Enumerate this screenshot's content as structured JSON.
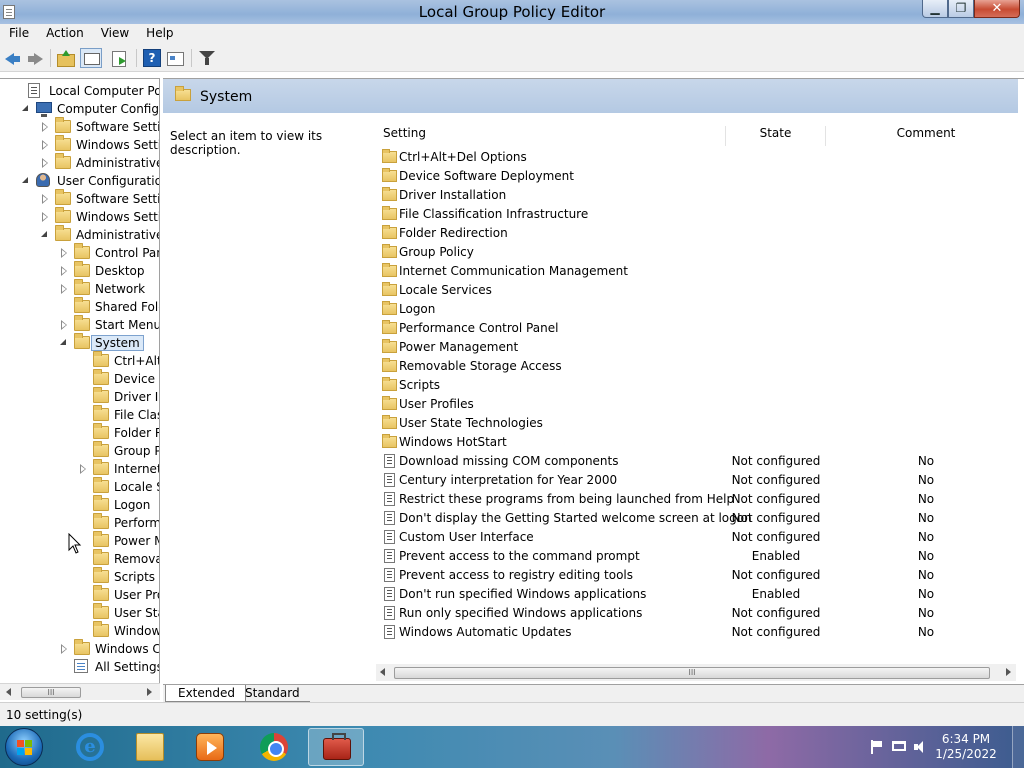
{
  "window": {
    "title": "Local Group Policy Editor"
  },
  "menu": [
    "File",
    "Action",
    "View",
    "Help"
  ],
  "toolbar": {
    "help_glyph": "?"
  },
  "tree": [
    {
      "label": "Local Computer Policy",
      "indent": 0,
      "arrow": "none",
      "icon": "policy"
    },
    {
      "label": "Computer Configura",
      "indent": 1,
      "arrow": "open",
      "icon": "computer"
    },
    {
      "label": "Software Settings",
      "indent": 2,
      "arrow": "closed",
      "icon": "folder"
    },
    {
      "label": "Windows Setting",
      "indent": 2,
      "arrow": "closed",
      "icon": "folder"
    },
    {
      "label": "Administrative Te",
      "indent": 2,
      "arrow": "closed",
      "icon": "folder"
    },
    {
      "label": "User Configuration",
      "indent": 1,
      "arrow": "open",
      "icon": "user"
    },
    {
      "label": "Software Settings",
      "indent": 2,
      "arrow": "closed",
      "icon": "folder"
    },
    {
      "label": "Windows Setting",
      "indent": 2,
      "arrow": "closed",
      "icon": "folder"
    },
    {
      "label": "Administrative Te",
      "indent": 2,
      "arrow": "open",
      "icon": "folder"
    },
    {
      "label": "Control Panel",
      "indent": 3,
      "arrow": "closed",
      "icon": "folder"
    },
    {
      "label": "Desktop",
      "indent": 3,
      "arrow": "closed",
      "icon": "folder"
    },
    {
      "label": "Network",
      "indent": 3,
      "arrow": "closed",
      "icon": "folder"
    },
    {
      "label": "Shared Folder",
      "indent": 3,
      "arrow": "none",
      "icon": "folder"
    },
    {
      "label": "Start Menu ar",
      "indent": 3,
      "arrow": "closed",
      "icon": "folder"
    },
    {
      "label": "System",
      "indent": 3,
      "arrow": "open",
      "icon": "folder",
      "selected": true
    },
    {
      "label": "Ctrl+Alt+I",
      "indent": 4,
      "arrow": "none",
      "icon": "folder"
    },
    {
      "label": "Device So",
      "indent": 4,
      "arrow": "none",
      "icon": "folder"
    },
    {
      "label": "Driver Inst",
      "indent": 4,
      "arrow": "none",
      "icon": "folder"
    },
    {
      "label": "File Classi",
      "indent": 4,
      "arrow": "none",
      "icon": "folder"
    },
    {
      "label": "Folder Rec",
      "indent": 4,
      "arrow": "none",
      "icon": "folder"
    },
    {
      "label": "Group Pol",
      "indent": 4,
      "arrow": "none",
      "icon": "folder"
    },
    {
      "label": "Internet C",
      "indent": 4,
      "arrow": "closed",
      "icon": "folder"
    },
    {
      "label": "Locale Ser",
      "indent": 4,
      "arrow": "none",
      "icon": "folder"
    },
    {
      "label": "Logon",
      "indent": 4,
      "arrow": "none",
      "icon": "folder"
    },
    {
      "label": "Performar",
      "indent": 4,
      "arrow": "none",
      "icon": "folder"
    },
    {
      "label": "Power Ma",
      "indent": 4,
      "arrow": "none",
      "icon": "folder"
    },
    {
      "label": "Removabl",
      "indent": 4,
      "arrow": "none",
      "icon": "folder"
    },
    {
      "label": "Scripts",
      "indent": 4,
      "arrow": "none",
      "icon": "folder"
    },
    {
      "label": "User Profi",
      "indent": 4,
      "arrow": "none",
      "icon": "folder"
    },
    {
      "label": "User State",
      "indent": 4,
      "arrow": "none",
      "icon": "folder"
    },
    {
      "label": "Windows",
      "indent": 4,
      "arrow": "none",
      "icon": "folder"
    },
    {
      "label": "Windows Cor",
      "indent": 3,
      "arrow": "closed",
      "icon": "folder"
    },
    {
      "label": "All Settings",
      "indent": 3,
      "arrow": "none",
      "icon": "settings"
    }
  ],
  "scroll_grip": "III",
  "right": {
    "header_title": "System",
    "description": "Select an item to view its description.",
    "columns": {
      "setting": "Setting",
      "state": "State",
      "comment": "Comment"
    },
    "rows": [
      {
        "name": "Ctrl+Alt+Del Options",
        "type": "folder",
        "state": "",
        "comment": ""
      },
      {
        "name": "Device Software Deployment",
        "type": "folder",
        "state": "",
        "comment": ""
      },
      {
        "name": "Driver Installation",
        "type": "folder",
        "state": "",
        "comment": ""
      },
      {
        "name": "File Classification Infrastructure",
        "type": "folder",
        "state": "",
        "comment": ""
      },
      {
        "name": "Folder Redirection",
        "type": "folder",
        "state": "",
        "comment": ""
      },
      {
        "name": "Group Policy",
        "type": "folder",
        "state": "",
        "comment": ""
      },
      {
        "name": "Internet Communication Management",
        "type": "folder",
        "state": "",
        "comment": ""
      },
      {
        "name": "Locale Services",
        "type": "folder",
        "state": "",
        "comment": ""
      },
      {
        "name": "Logon",
        "type": "folder",
        "state": "",
        "comment": ""
      },
      {
        "name": "Performance Control Panel",
        "type": "folder",
        "state": "",
        "comment": ""
      },
      {
        "name": "Power Management",
        "type": "folder",
        "state": "",
        "comment": ""
      },
      {
        "name": "Removable Storage Access",
        "type": "folder",
        "state": "",
        "comment": ""
      },
      {
        "name": "Scripts",
        "type": "folder",
        "state": "",
        "comment": ""
      },
      {
        "name": "User Profiles",
        "type": "folder",
        "state": "",
        "comment": ""
      },
      {
        "name": "User State Technologies",
        "type": "folder",
        "state": "",
        "comment": ""
      },
      {
        "name": "Windows HotStart",
        "type": "folder",
        "state": "",
        "comment": ""
      },
      {
        "name": "Download missing COM components",
        "type": "policy",
        "state": "Not configured",
        "comment": "No"
      },
      {
        "name": "Century interpretation for Year 2000",
        "type": "policy",
        "state": "Not configured",
        "comment": "No"
      },
      {
        "name": "Restrict these programs from being launched from Help",
        "type": "policy",
        "state": "Not configured",
        "comment": "No"
      },
      {
        "name": "Don't display the Getting Started welcome screen at logon",
        "type": "policy",
        "state": "Not configured",
        "comment": "No"
      },
      {
        "name": "Custom User Interface",
        "type": "policy",
        "state": "Not configured",
        "comment": "No"
      },
      {
        "name": "Prevent access to the command prompt",
        "type": "policy",
        "state": "Enabled",
        "comment": "No"
      },
      {
        "name": "Prevent access to registry editing tools",
        "type": "policy",
        "state": "Not configured",
        "comment": "No"
      },
      {
        "name": "Don't run specified Windows applications",
        "type": "policy",
        "state": "Enabled",
        "comment": "No"
      },
      {
        "name": "Run only specified Windows applications",
        "type": "policy",
        "state": "Not configured",
        "comment": "No"
      },
      {
        "name": "Windows Automatic Updates",
        "type": "policy",
        "state": "Not configured",
        "comment": "No"
      }
    ]
  },
  "tabs": {
    "extended": "Extended",
    "standard": "Standard"
  },
  "status": {
    "text": "10 setting(s)"
  },
  "taskbar": {
    "time": "6:34 PM",
    "date": "1/25/2022",
    "ie_glyph": "e"
  },
  "colors": {
    "title_gradient": "#8fb0d8",
    "taskbar": "#3d8ab1",
    "selection": "#dbe9f8"
  }
}
